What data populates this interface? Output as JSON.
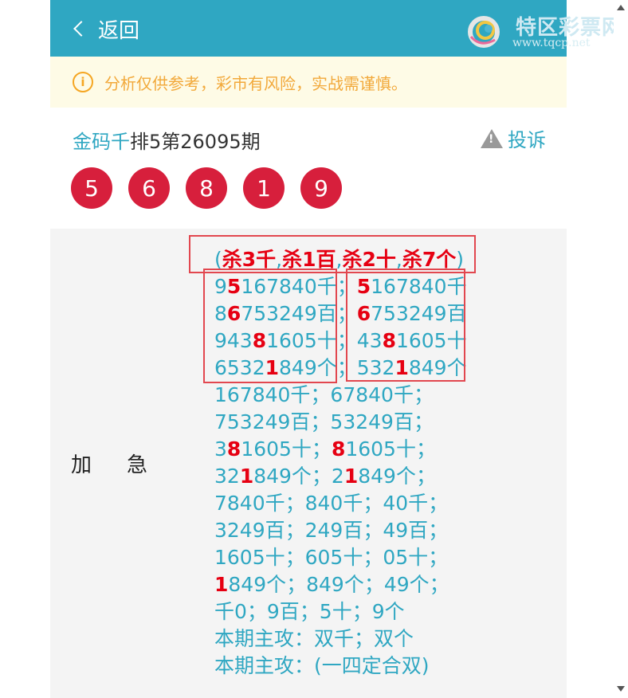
{
  "header": {
    "back_label": "返回",
    "logo_name": "特区彩票网",
    "logo_url": "www.tqcp.net"
  },
  "notice": {
    "icon": "info-icon",
    "text": "分析仅供参考，彩市有风险，实战需谨慎。"
  },
  "post": {
    "title_keyword": "金码千",
    "title_rest": "排5第26095期",
    "complain_label": "投诉"
  },
  "balls": [
    "5",
    "6",
    "8",
    "1",
    "9"
  ],
  "row_label": "加急",
  "kill_line": {
    "open": "(",
    "k1": "杀3千",
    "sep1": ",",
    "k2": "杀1百",
    "sep2": ",",
    "k3": "杀2十",
    "sep3": ",",
    "k4": "杀7个",
    "close": ")"
  },
  "lines": [
    [
      [
        "9",
        ""
      ],
      [
        "5",
        "r"
      ],
      [
        "167840千；",
        ""
      ],
      [
        "5",
        "r"
      ],
      [
        "167840千",
        ""
      ]
    ],
    [
      [
        "8",
        ""
      ],
      [
        "6",
        "r"
      ],
      [
        "753249百；",
        ""
      ],
      [
        "6",
        "r"
      ],
      [
        "753249百",
        ""
      ]
    ],
    [
      [
        "943",
        ""
      ],
      [
        "8",
        "r"
      ],
      [
        "1605十；43",
        ""
      ],
      [
        "8",
        "r"
      ],
      [
        "1605十",
        ""
      ]
    ],
    [
      [
        "6532",
        ""
      ],
      [
        "1",
        "r"
      ],
      [
        "849个；532",
        ""
      ],
      [
        "1",
        "r"
      ],
      [
        "849个",
        ""
      ]
    ],
    [
      [
        "167840千；67840千；",
        ""
      ]
    ],
    [
      [
        "753249百；53249百；",
        ""
      ]
    ],
    [
      [
        "3",
        ""
      ],
      [
        "8",
        "r"
      ],
      [
        "1605十；",
        ""
      ],
      [
        "8",
        "r"
      ],
      [
        "1605十；",
        ""
      ]
    ],
    [
      [
        "32",
        ""
      ],
      [
        "1",
        "r"
      ],
      [
        "849个；2",
        ""
      ],
      [
        "1",
        "r"
      ],
      [
        "849个；",
        ""
      ]
    ],
    [
      [
        "7840千；840千；40千；",
        ""
      ]
    ],
    [
      [
        "3249百；249百；49百；",
        ""
      ]
    ],
    [
      [
        "1605十；605十；05十；",
        ""
      ]
    ],
    [
      [
        "1",
        "r"
      ],
      [
        "849个；849个；49个；",
        ""
      ]
    ],
    [
      [
        "千0；9百；5十；9个",
        ""
      ]
    ],
    [
      [
        "本期主攻：双千；双个",
        ""
      ]
    ],
    [
      [
        "本期主攻：(一四定合双)",
        ""
      ]
    ]
  ]
}
